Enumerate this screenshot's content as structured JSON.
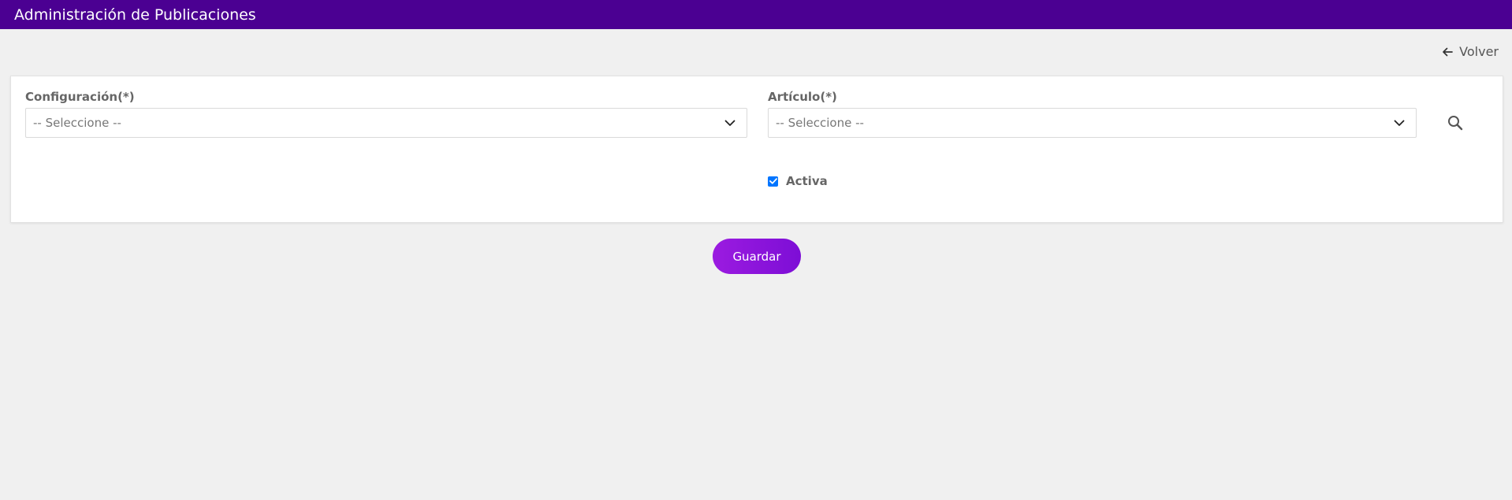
{
  "header": {
    "title": "Administración de Publicaciones"
  },
  "back_link": {
    "label": "Volver",
    "icon": "arrow-left-icon"
  },
  "form": {
    "configuracion": {
      "label": "Configuración(*)",
      "selected": "-- Seleccione --",
      "icon": "chevron-down-icon"
    },
    "articulo": {
      "label": "Artículo(*)",
      "selected": "-- Seleccione --",
      "icon": "chevron-down-icon"
    },
    "search_icon": "search-icon",
    "activa": {
      "label": "Activa",
      "checked": true
    }
  },
  "actions": {
    "save_label": "Guardar"
  },
  "colors": {
    "header_bg": "#4b0092",
    "button_gradient_start": "#9b1be0",
    "button_gradient_end": "#7d0ed6",
    "checkbox": "#0075ff",
    "page_bg": "#f0f0f0"
  }
}
